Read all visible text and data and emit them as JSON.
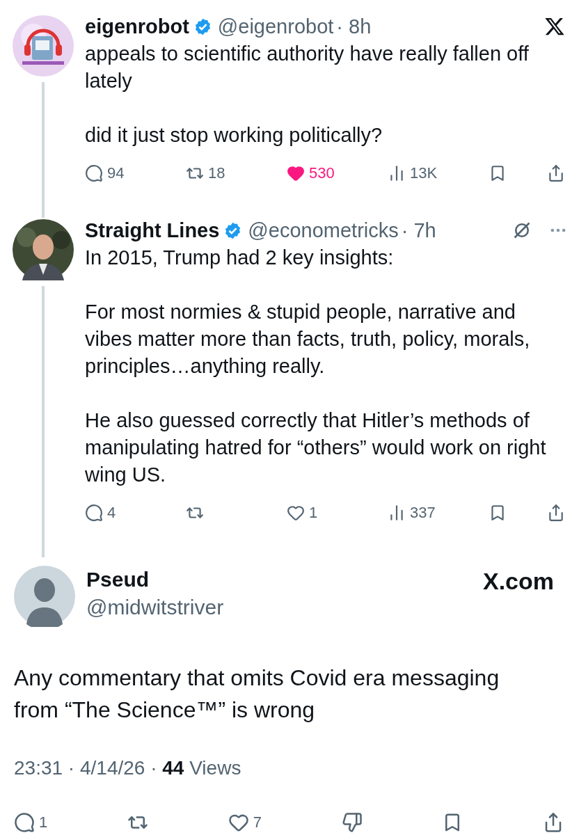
{
  "posts": [
    {
      "name": "eigenrobot",
      "verified": true,
      "handle": "@eigenrobot",
      "time": "· 8h",
      "kind": "logo",
      "paragraphs": [
        "appeals to scientific authority have really fallen off lately",
        "did it just stop working politically?"
      ],
      "actions": [
        {
          "kind": "reply",
          "count": "94"
        },
        {
          "kind": "repost",
          "count": "18"
        },
        {
          "kind": "like",
          "count": "530",
          "liked": true
        },
        {
          "kind": "views",
          "count": "13K"
        },
        {
          "kind": "bookmark"
        },
        {
          "kind": "share"
        }
      ]
    },
    {
      "name": "Straight Lines",
      "verified": true,
      "handle": "@econometricks",
      "time": "· 7h",
      "kind": "menu",
      "paragraphs": [
        "In 2015, Trump had 2 key insights:",
        "For most normies & stupid people, narrative and vibes matter more than facts, truth, policy, morals, principles…anything really.",
        "He also guessed correctly that Hitler’s methods of manipulating hatred for “others” would work on right wing US."
      ],
      "actions": [
        {
          "kind": "reply",
          "count": "4"
        },
        {
          "kind": "repost"
        },
        {
          "kind": "like",
          "count": "1",
          "liked": false
        },
        {
          "kind": "views",
          "count": "337"
        },
        {
          "kind": "bookmark"
        },
        {
          "kind": "share"
        }
      ]
    }
  ],
  "reply": {
    "name": "Pseud",
    "handle": "@midwitstriver",
    "site": "X.com",
    "text": "Any commentary that omits Covid era messaging from “The Science™” is wrong",
    "meta": "23:31 · 4/14/26 · **44** Views",
    "actions": [
      {
        "kind": "reply",
        "count": "1"
      },
      {
        "kind": "repost"
      },
      {
        "kind": "like",
        "count": "7",
        "liked": false
      },
      {
        "kind": "dislike"
      },
      {
        "kind": "bookmark"
      },
      {
        "kind": "share"
      }
    ]
  }
}
